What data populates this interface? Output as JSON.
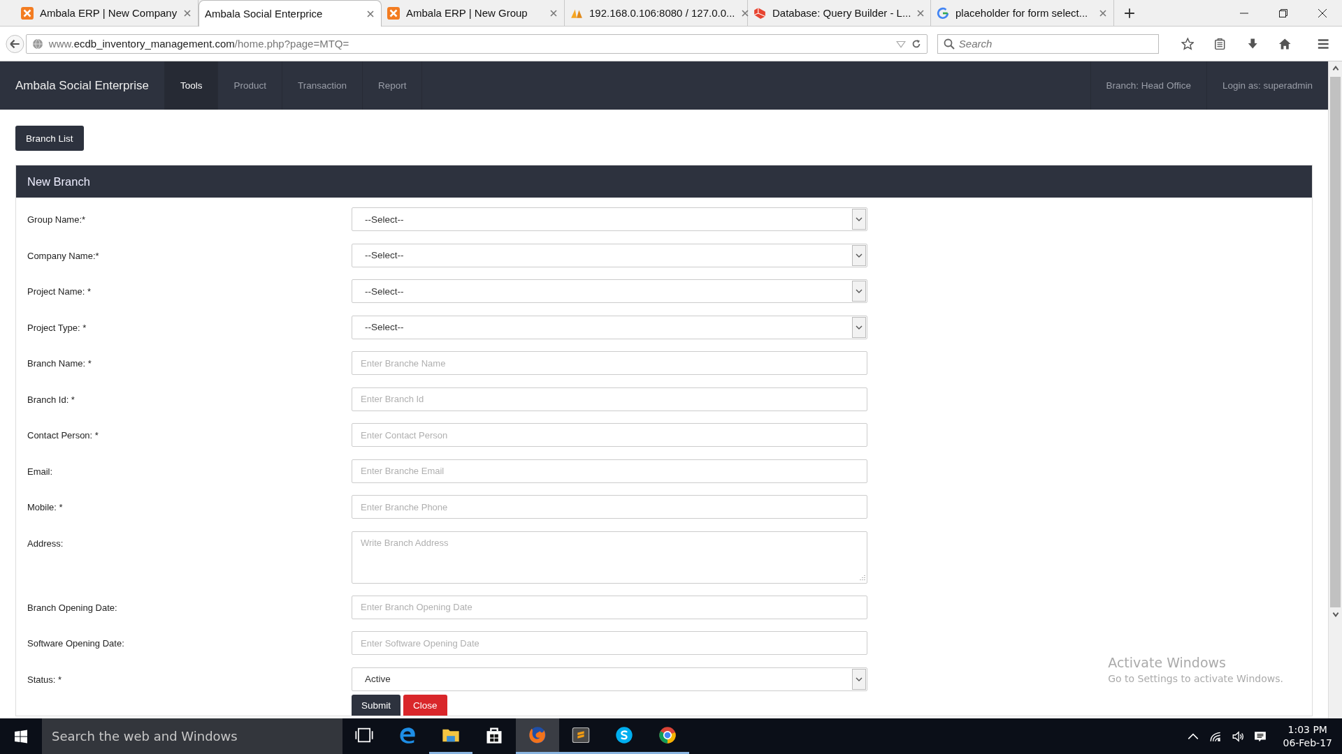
{
  "browser": {
    "tabs": [
      {
        "title": "Ambala ERP | New Company",
        "selected": false
      },
      {
        "title": "Ambala Social Enterprice",
        "selected": true
      },
      {
        "title": "Ambala ERP | New Group",
        "selected": false
      },
      {
        "title": "192.168.0.106:8080 / 127.0.0...",
        "selected": false
      },
      {
        "title": "Database: Query Builder - L...",
        "selected": false
      },
      {
        "title": "placeholder for form select...",
        "selected": false
      }
    ],
    "address": "www.**ecdb_inventory_management.com**/home.php?page=MTQ=",
    "search": {
      "placeholder": "Search"
    }
  },
  "navbar": {
    "brand": "Ambala Social Enterprise",
    "items": [
      {
        "label": "Tools",
        "selected": true
      },
      {
        "label": "Product",
        "selected": false
      },
      {
        "label": "Transaction",
        "selected": false
      },
      {
        "label": "Report",
        "selected": false
      }
    ],
    "right": [
      "Branch: Head Office",
      "Login as: superadmin"
    ]
  },
  "branch_list_button": "Branch List",
  "panel": {
    "title": "New Branch",
    "fields": [
      {
        "kind": "select",
        "label": "Group Name:*",
        "value": "--Select--"
      },
      {
        "kind": "select",
        "label": "Company Name:*",
        "value": "--Select--"
      },
      {
        "kind": "select",
        "label": "Project Name: *",
        "value": "--Select--"
      },
      {
        "kind": "select",
        "label": "Project Type: *",
        "value": "--Select--"
      },
      {
        "kind": "input",
        "label": "Branch Name: *",
        "placeholder": "Enter Branche Name"
      },
      {
        "kind": "input",
        "label": "Branch Id: *",
        "placeholder": "Enter Branch Id"
      },
      {
        "kind": "input",
        "label": "Contact Person: *",
        "placeholder": "Enter Contact Person"
      },
      {
        "kind": "input",
        "label": "Email:",
        "placeholder": "Enter Branche Email"
      },
      {
        "kind": "input",
        "label": "Mobile: *",
        "placeholder": "Enter Branche Phone"
      },
      {
        "kind": "textarea",
        "label": "Address:",
        "placeholder": "Write Branch Address"
      },
      {
        "kind": "input",
        "label": "Branch Opening Date:",
        "placeholder": "Enter Branch Opening Date"
      },
      {
        "kind": "input",
        "label": "Software Opening Date:",
        "placeholder": "Enter Software Opening Date"
      },
      {
        "kind": "select",
        "label": "Status: *",
        "value": "Active"
      }
    ],
    "buttons": [
      {
        "kind": "primary",
        "label": "Submit"
      },
      {
        "kind": "danger",
        "label": "Close"
      }
    ]
  },
  "activation_notice": {
    "title": "Activate Windows",
    "text": "Go to Settings to activate Windows."
  },
  "taskbar": {
    "search": {
      "placeholder": "Search the web and Windows"
    },
    "apps": [
      {
        "selected": false,
        "running": false
      },
      {
        "selected": false,
        "running": false
      },
      {
        "selected": false,
        "running": true
      },
      {
        "selected": false,
        "running": false
      },
      {
        "selected": true,
        "running": true
      },
      {
        "selected": false,
        "running": true
      },
      {
        "selected": false,
        "running": true
      },
      {
        "selected": false,
        "running": true
      }
    ],
    "time": "1:03 PM",
    "date": "06-Feb-17"
  }
}
